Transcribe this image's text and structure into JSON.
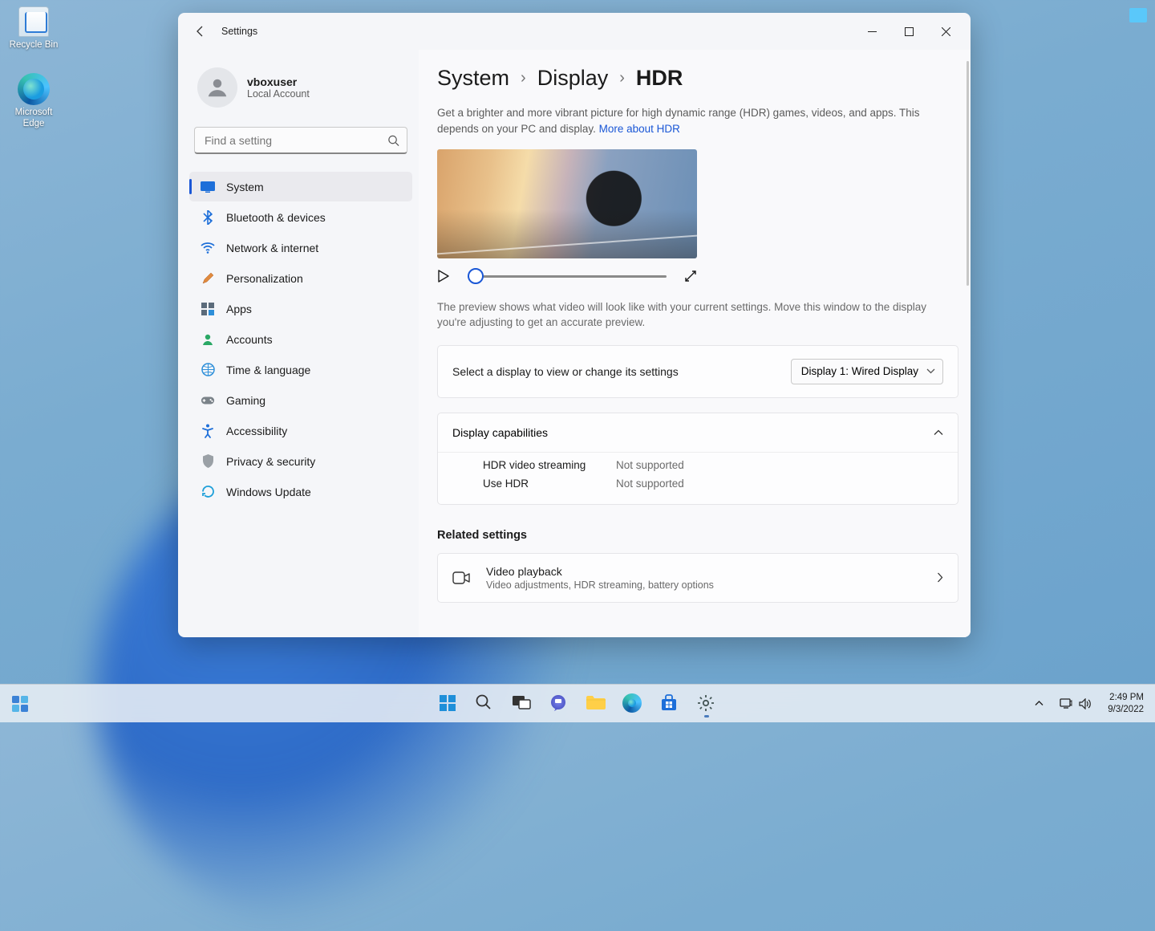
{
  "desktop": {
    "icons": [
      {
        "label": "Recycle Bin"
      },
      {
        "label": "Microsoft Edge"
      }
    ]
  },
  "window": {
    "title": "Settings",
    "user": {
      "name": "vboxuser",
      "sub": "Local Account"
    },
    "search_placeholder": "Find a setting",
    "nav": [
      {
        "id": "system",
        "label": "System",
        "active": true
      },
      {
        "id": "bluetooth",
        "label": "Bluetooth & devices"
      },
      {
        "id": "network",
        "label": "Network & internet"
      },
      {
        "id": "personalization",
        "label": "Personalization"
      },
      {
        "id": "apps",
        "label": "Apps"
      },
      {
        "id": "accounts",
        "label": "Accounts"
      },
      {
        "id": "time",
        "label": "Time & language"
      },
      {
        "id": "gaming",
        "label": "Gaming"
      },
      {
        "id": "accessibility",
        "label": "Accessibility"
      },
      {
        "id": "privacy",
        "label": "Privacy & security"
      },
      {
        "id": "update",
        "label": "Windows Update"
      }
    ],
    "breadcrumb": [
      "System",
      "Display",
      "HDR"
    ],
    "desc": "Get a brighter and more vibrant picture for high dynamic range (HDR) games, videos, and apps. This depends on your PC and display. ",
    "desc_link": "More about HDR",
    "preview_caption": "The preview shows what video will look like with your current settings. Move this window to the display you're adjusting to get an accurate preview.",
    "select_display": {
      "label": "Select a display to view or change its settings",
      "value": "Display 1: Wired Display"
    },
    "capabilities": {
      "header": "Display capabilities",
      "rows": [
        {
          "k": "HDR video streaming",
          "v": "Not supported"
        },
        {
          "k": "Use HDR",
          "v": "Not supported"
        }
      ]
    },
    "related_header": "Related settings",
    "video_playback": {
      "title": "Video playback",
      "sub": "Video adjustments, HDR streaming, battery options"
    }
  },
  "taskbar": {
    "time": "2:49 PM",
    "date": "9/3/2022"
  }
}
